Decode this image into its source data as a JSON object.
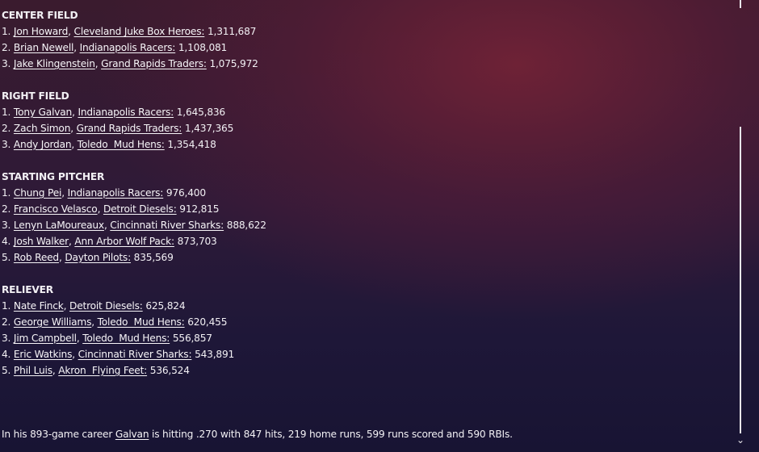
{
  "sections": [
    {
      "title": "CENTER FIELD",
      "entries": [
        {
          "rank": "1.",
          "player": "Jon Howard",
          "team": "Cleveland Juke Box Heroes:",
          "votes": "1,311,687"
        },
        {
          "rank": "2.",
          "player": "Brian Newell",
          "team": "Indianapolis Racers:",
          "votes": "1,108,081"
        },
        {
          "rank": "3.",
          "player": "Jake Klingenstein",
          "team": "Grand Rapids Traders:",
          "votes": "1,075,972"
        }
      ]
    },
    {
      "title": "RIGHT FIELD",
      "entries": [
        {
          "rank": "1.",
          "player": "Tony Galvan",
          "team": "Indianapolis Racers:",
          "votes": "1,645,836"
        },
        {
          "rank": "2.",
          "player": "Zach Simon",
          "team": "Grand Rapids Traders:",
          "votes": "1,437,365"
        },
        {
          "rank": "3.",
          "player": "Andy Jordan",
          "team": "Toledo  Mud Hens:",
          "votes": "1,354,418"
        }
      ]
    },
    {
      "title": "STARTING PITCHER",
      "entries": [
        {
          "rank": "1.",
          "player": "Chung Pei",
          "team": "Indianapolis Racers:",
          "votes": "976,400"
        },
        {
          "rank": "2.",
          "player": "Francisco Velasco",
          "team": "Detroit Diesels:",
          "votes": "912,815"
        },
        {
          "rank": "3.",
          "player": "Lenyn LaMoureaux",
          "team": "Cincinnati River Sharks:",
          "votes": "888,622"
        },
        {
          "rank": "4.",
          "player": "Josh Walker",
          "team": "Ann Arbor Wolf Pack:",
          "votes": "873,703"
        },
        {
          "rank": "5.",
          "player": "Rob Reed",
          "team": "Dayton Pilots:",
          "votes": "835,569"
        }
      ]
    },
    {
      "title": "RELIEVER",
      "entries": [
        {
          "rank": "1.",
          "player": "Nate Finck",
          "team": "Detroit Diesels:",
          "votes": "625,824"
        },
        {
          "rank": "2.",
          "player": "George Williams",
          "team": "Toledo  Mud Hens:",
          "votes": "620,455"
        },
        {
          "rank": "3.",
          "player": "Jim Campbell",
          "team": "Toledo  Mud Hens:",
          "votes": "556,857"
        },
        {
          "rank": "4.",
          "player": "Eric Watkins",
          "team": "Cincinnati River Sharks:",
          "votes": "543,891"
        },
        {
          "rank": "5.",
          "player": "Phil Luis",
          "team": "Akron  Flying Feet:",
          "votes": "536,524"
        }
      ]
    }
  ],
  "summary": {
    "prefix": "In his 893-game career ",
    "player_link": "Galvan",
    "suffix": " is hitting .270 with 847 hits, 219 home runs, 599 runs scored and 590 RBIs."
  },
  "scrollbar": {
    "down_arrow_icon": "chevron-down-icon",
    "down_arrow_glyph": "⌄"
  }
}
